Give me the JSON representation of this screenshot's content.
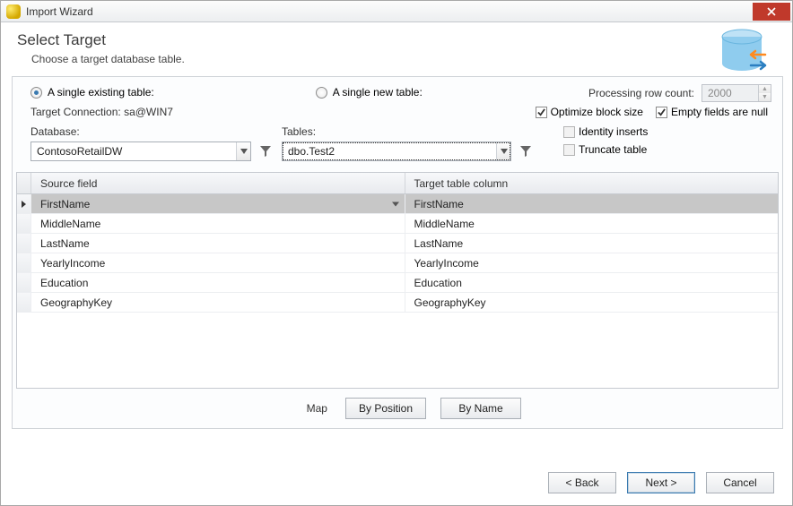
{
  "window": {
    "title": "Import Wizard"
  },
  "header": {
    "title": "Select Target",
    "subtitle": "Choose a target database table."
  },
  "options": {
    "single_existing_label": "A single existing table:",
    "single_new_label": "A single new table:",
    "selected": "existing"
  },
  "connection": {
    "label_prefix": "Target Connection: ",
    "value": "sa@WIN7"
  },
  "processing": {
    "label": "Processing row count:",
    "value": "2000"
  },
  "checks": {
    "optimize_label": "Optimize block size",
    "optimize_checked": true,
    "emptynull_label": "Empty fields are null",
    "emptynull_checked": true,
    "identity_label": "Identity inserts",
    "identity_checked": false,
    "truncate_label": "Truncate table",
    "truncate_checked": false
  },
  "database": {
    "label": "Database:",
    "value": "ContosoRetailDW"
  },
  "tables": {
    "label": "Tables:",
    "value": "dbo.Test2"
  },
  "grid": {
    "cols": {
      "source": "Source field",
      "target": "Target table column"
    },
    "rows": [
      {
        "source": "FirstName",
        "target": "FirstName"
      },
      {
        "source": "MiddleName",
        "target": "MiddleName"
      },
      {
        "source": "LastName",
        "target": "LastName"
      },
      {
        "source": "YearlyIncome",
        "target": "YearlyIncome"
      },
      {
        "source": "Education",
        "target": "Education"
      },
      {
        "source": "GeographyKey",
        "target": "GeographyKey"
      }
    ]
  },
  "map": {
    "label": "Map",
    "by_position": "By Position",
    "by_name": "By Name"
  },
  "footer": {
    "back": "< Back",
    "next": "Next >",
    "cancel": "Cancel"
  }
}
